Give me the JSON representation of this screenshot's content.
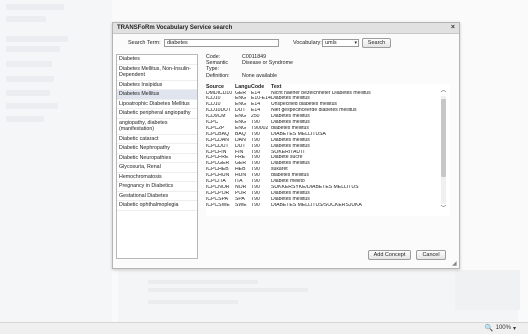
{
  "dialog": {
    "title": "TRANSFoRm Vocabulary Service search",
    "close_label": "×",
    "search_term_label": "Search Term:",
    "search_term_value": "diabetes",
    "vocabulary_label": "Vocabulary:",
    "vocabulary_value": "umls",
    "search_button": "Search",
    "add_concept_button": "Add Concept",
    "cancel_button": "Cancel"
  },
  "results": [
    "Diabetes",
    "Diabetes Mellitus, Non-Insulin-Dependent",
    "Diabetes Insipidus",
    "Diabetes Mellitus",
    "Lipoatrophic Diabetes Mellitus",
    "Diabetic peripheral angiopathy",
    "angiopathy, diabetes (manifestation)",
    "Diabetic cataract",
    "Diabetic Nephropathy",
    "Diabetic Neuropathies",
    "Glycosuria, Renal",
    "Hemochromatosis",
    "Pregnancy in Diabetics",
    "Gestational Diabetes",
    "Diabetic ophthalmoplegia"
  ],
  "selected_result_index": 3,
  "details": {
    "code_label": "Code:",
    "code_value": "C0011849",
    "semantic_type_label": "Semantic Type:",
    "semantic_type_value": "Disease or Syndrome",
    "definition_label": "Definition:",
    "definition_value": "None available"
  },
  "codes_table": {
    "headers": [
      "Source",
      "Language",
      "Code",
      "Text"
    ],
    "rows": [
      [
        "DMDICD10",
        "GER",
        "E14",
        "Nicht naeher bezeichneter Diabetes mellitus"
      ],
      [
        "ICD10",
        "ENG",
        "E10-E14.9",
        "Diabetes mellitus"
      ],
      [
        "ICD10",
        "ENG",
        "E14",
        "Unspecified diabetes mellitus"
      ],
      [
        "ICD10DUT",
        "DUT",
        "E14",
        "Niet gespecificeerde diabetes mellitus"
      ],
      [
        "ICD9CM",
        "ENG",
        "250",
        "Diabetes mellitus"
      ],
      [
        "ICPC",
        "ENG",
        "T90",
        "Diabetes mellitus"
      ],
      [
        "ICPC2P",
        "ENG",
        "T90002",
        "diabetes mellitus"
      ],
      [
        "ICPCBAQ",
        "BAQ",
        "T90",
        "DIABETES MELLITUSA"
      ],
      [
        "ICPCDAN",
        "DAN",
        "T90",
        "Diabetes mellitus"
      ],
      [
        "ICPCDUT",
        "DUT",
        "T90",
        "Diabetes mellitus"
      ],
      [
        "ICPCFIN",
        "FIN",
        "T90",
        "SOKERITAUTI"
      ],
      [
        "ICPCFRE",
        "FRE",
        "T90",
        "Diabete sucre"
      ],
      [
        "ICPCGER",
        "GER",
        "T90",
        "Diabetes mellitus"
      ],
      [
        "ICPCHEB",
        "HEB",
        "T90",
        "sukaret"
      ],
      [
        "ICPCHUN",
        "HUN",
        "T90",
        "diabetes mellitus"
      ],
      [
        "ICPCITA",
        "ITA",
        "T90",
        "Diabete mellito"
      ],
      [
        "ICPCNOR",
        "NOR",
        "T90",
        "SUKKERSYKE/DIABETES MELLITUS"
      ],
      [
        "ICPCPOR",
        "POR",
        "T90",
        "Diabetes mellitus"
      ],
      [
        "ICPCSPA",
        "SPA",
        "T90",
        "Diabetes mellitus"
      ],
      [
        "ICPCSWE",
        "SWE",
        "T90",
        "DIABETES MELLITUS/SOCKERSJUKA"
      ]
    ]
  },
  "status_bar": {
    "zoom_label": "100%"
  }
}
